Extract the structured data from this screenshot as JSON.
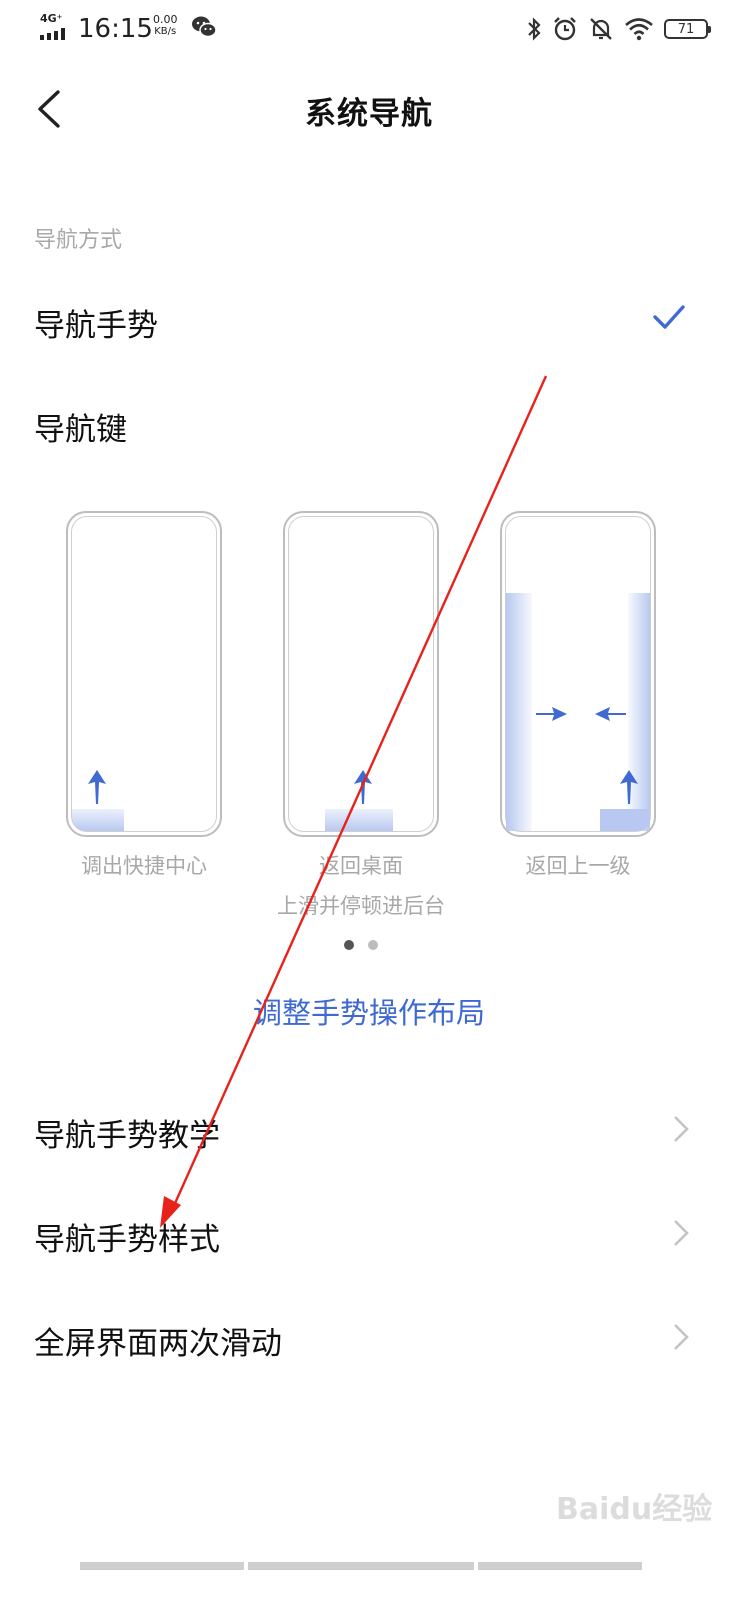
{
  "status_bar": {
    "network": "4G⁺",
    "time": "16:15",
    "speed_value": "0.00",
    "speed_unit": "KB/s",
    "battery": "71",
    "icons": [
      "wechat-icon",
      "bluetooth-icon",
      "alarm-icon",
      "mute-bell-icon",
      "wifi-icon",
      "battery-icon"
    ]
  },
  "header": {
    "title": "系统导航",
    "back_icon": "chevron-left-icon"
  },
  "section": {
    "label": "导航方式"
  },
  "options": [
    {
      "label": "导航手势",
      "selected": true
    },
    {
      "label": "导航键",
      "selected": false
    }
  ],
  "demo": {
    "captions": [
      "调出快捷中心",
      "返回桌面",
      "返回上一级"
    ],
    "subcaption": "上滑并停顿进后台",
    "page_index": 1,
    "page_count": 2
  },
  "adjust_link": "调整手势操作布局",
  "menu": [
    {
      "label": "导航手势教学"
    },
    {
      "label": "导航手势样式"
    },
    {
      "label": "全屏界面两次滑动"
    }
  ],
  "watermark": "Baidu经验",
  "colors": {
    "accent": "#3e6ad2",
    "annotation": "#e8221b"
  }
}
